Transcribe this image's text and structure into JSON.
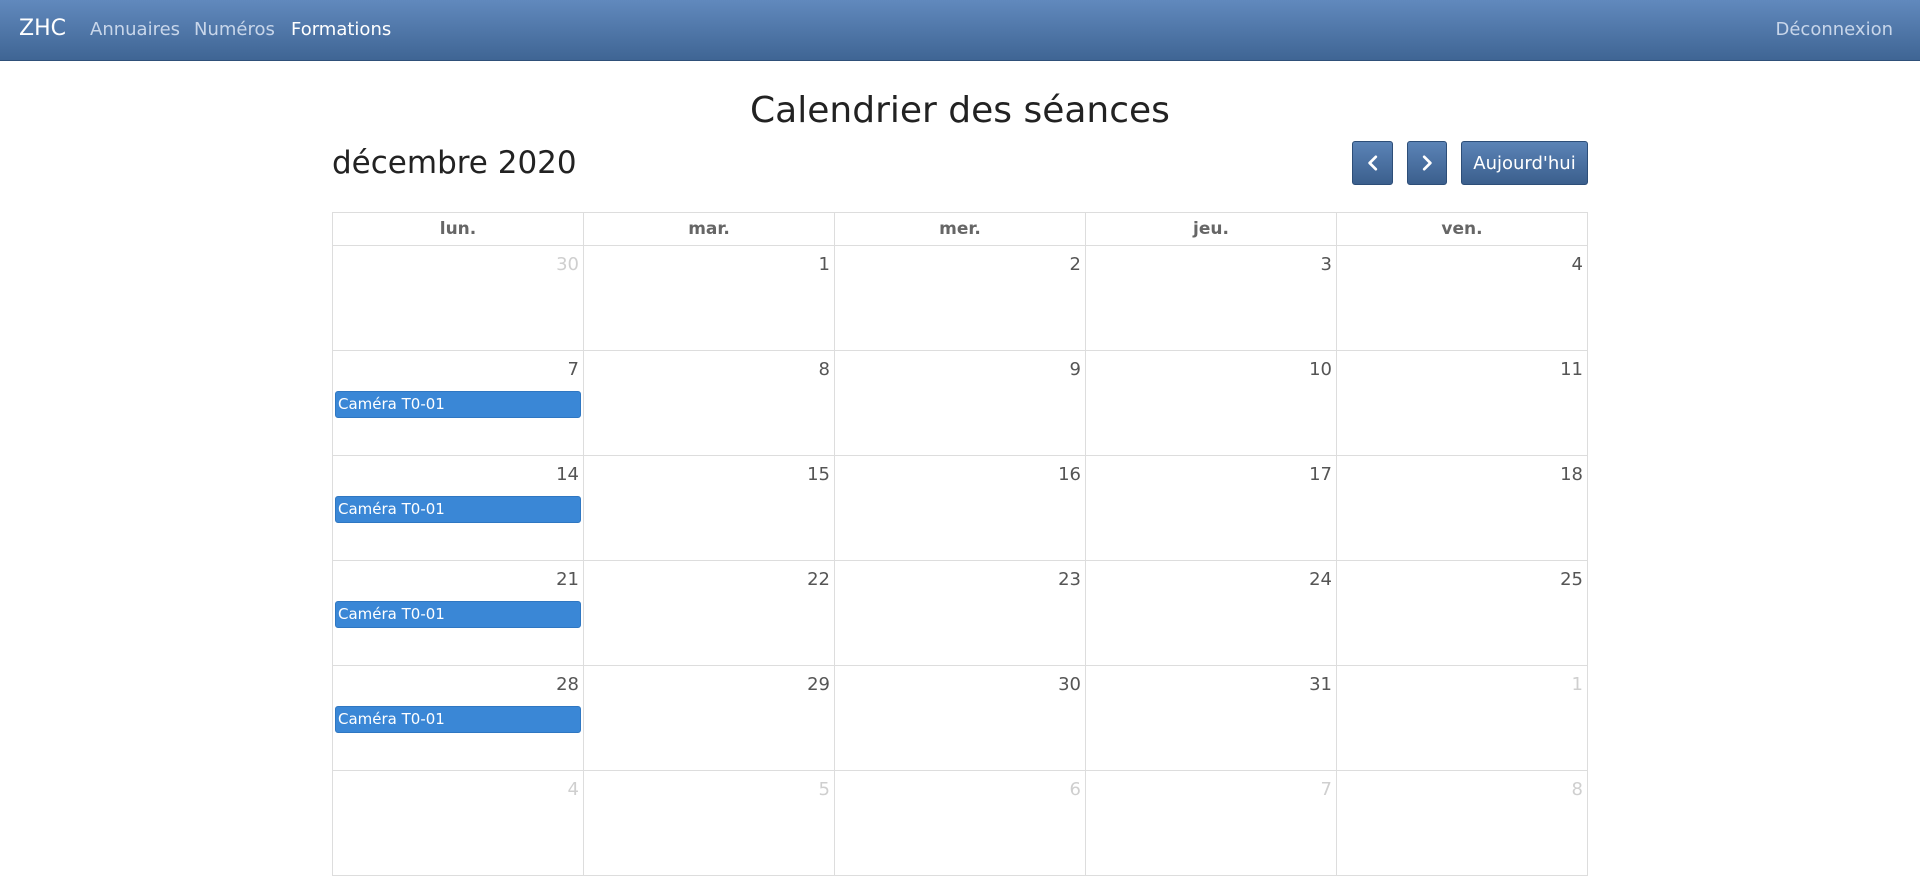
{
  "navbar": {
    "brand": "ZHC",
    "links": [
      {
        "label": "Annuaires",
        "active": false
      },
      {
        "label": "Numéros",
        "active": false
      },
      {
        "label": "Formations",
        "active": true
      }
    ],
    "logout_label": "Déconnexion"
  },
  "page": {
    "title": "Calendrier des séances"
  },
  "calendar": {
    "month_label": "décembre 2020",
    "prev_icon": "chevron-left-icon",
    "next_icon": "chevron-right-icon",
    "today_label": "Aujourd'hui",
    "weekdays": [
      "lun.",
      "mar.",
      "mer.",
      "jeu.",
      "ven."
    ],
    "weeks": [
      [
        {
          "day": "30",
          "other": true,
          "event": null
        },
        {
          "day": "1",
          "other": false,
          "event": null
        },
        {
          "day": "2",
          "other": false,
          "event": null
        },
        {
          "day": "3",
          "other": false,
          "event": null
        },
        {
          "day": "4",
          "other": false,
          "event": null
        }
      ],
      [
        {
          "day": "7",
          "other": false,
          "event": "Caméra T0-01"
        },
        {
          "day": "8",
          "other": false,
          "event": null
        },
        {
          "day": "9",
          "other": false,
          "event": null
        },
        {
          "day": "10",
          "other": false,
          "event": null
        },
        {
          "day": "11",
          "other": false,
          "event": null
        }
      ],
      [
        {
          "day": "14",
          "other": false,
          "event": "Caméra T0-01"
        },
        {
          "day": "15",
          "other": false,
          "event": null
        },
        {
          "day": "16",
          "other": false,
          "event": null
        },
        {
          "day": "17",
          "other": false,
          "event": null
        },
        {
          "day": "18",
          "other": false,
          "event": null
        }
      ],
      [
        {
          "day": "21",
          "other": false,
          "event": "Caméra T0-01"
        },
        {
          "day": "22",
          "other": false,
          "event": null
        },
        {
          "day": "23",
          "other": false,
          "event": null
        },
        {
          "day": "24",
          "other": false,
          "event": null
        },
        {
          "day": "25",
          "other": false,
          "event": null
        }
      ],
      [
        {
          "day": "28",
          "other": false,
          "event": "Caméra T0-01"
        },
        {
          "day": "29",
          "other": false,
          "event": null
        },
        {
          "day": "30",
          "other": false,
          "event": null
        },
        {
          "day": "31",
          "other": false,
          "event": null
        },
        {
          "day": "1",
          "other": true,
          "event": null
        }
      ],
      [
        {
          "day": "4",
          "other": true,
          "event": null
        },
        {
          "day": "5",
          "other": true,
          "event": null
        },
        {
          "day": "6",
          "other": true,
          "event": null
        },
        {
          "day": "7",
          "other": true,
          "event": null
        },
        {
          "day": "8",
          "other": true,
          "event": null
        }
      ]
    ]
  },
  "colors": {
    "navbar_top": "#6189bd",
    "navbar_bottom": "#3f6594",
    "event_bg": "#3a87d6",
    "other_month_text": "#cfcfcf"
  }
}
